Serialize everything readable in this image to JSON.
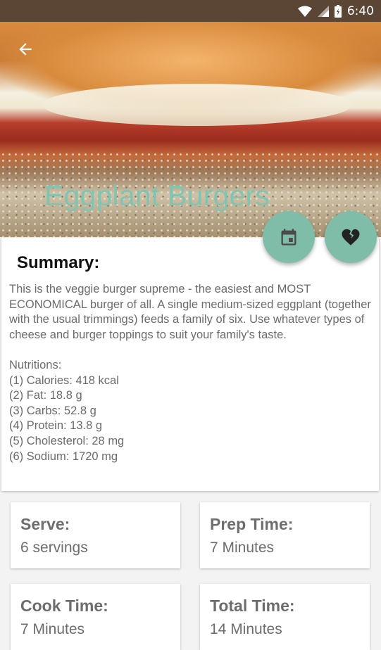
{
  "status": {
    "time": "6:40"
  },
  "recipe": {
    "title": "Eggplant Burgers"
  },
  "summary": {
    "heading": "Summary:",
    "text": "This is the veggie burger supreme - the easiest and MOST ECONOMICAL burger of all. A single medium-sized eggplant (together with the usual trimmings) feeds a family of six. Use whatever types of cheese and burger toppings to suit your family's taste.\n\nNutritions:\n(1) Calories: 418 kcal\n(2) Fat: 18.8 g\n(3) Carbs: 52.8 g\n(4) Protein: 13.8 g\n(5) Cholesterol: 28 mg\n(6) Sodium: 1720 mg"
  },
  "info": {
    "serve": {
      "label": "Serve:",
      "value": "6 servings"
    },
    "prep": {
      "label": "Prep Time:",
      "value": "7 Minutes"
    },
    "cook": {
      "label": "Cook Time:",
      "value": "7 Minutes"
    },
    "total": {
      "label": "Total Time:",
      "value": "14 Minutes"
    }
  },
  "icons": {
    "back": "arrow-back-icon",
    "calendar": "calendar-icon",
    "favorite": "heart-broken-icon"
  },
  "colors": {
    "status_bar": "#5b4535",
    "accent": "#7fbda9",
    "title": "#80c4b1"
  }
}
